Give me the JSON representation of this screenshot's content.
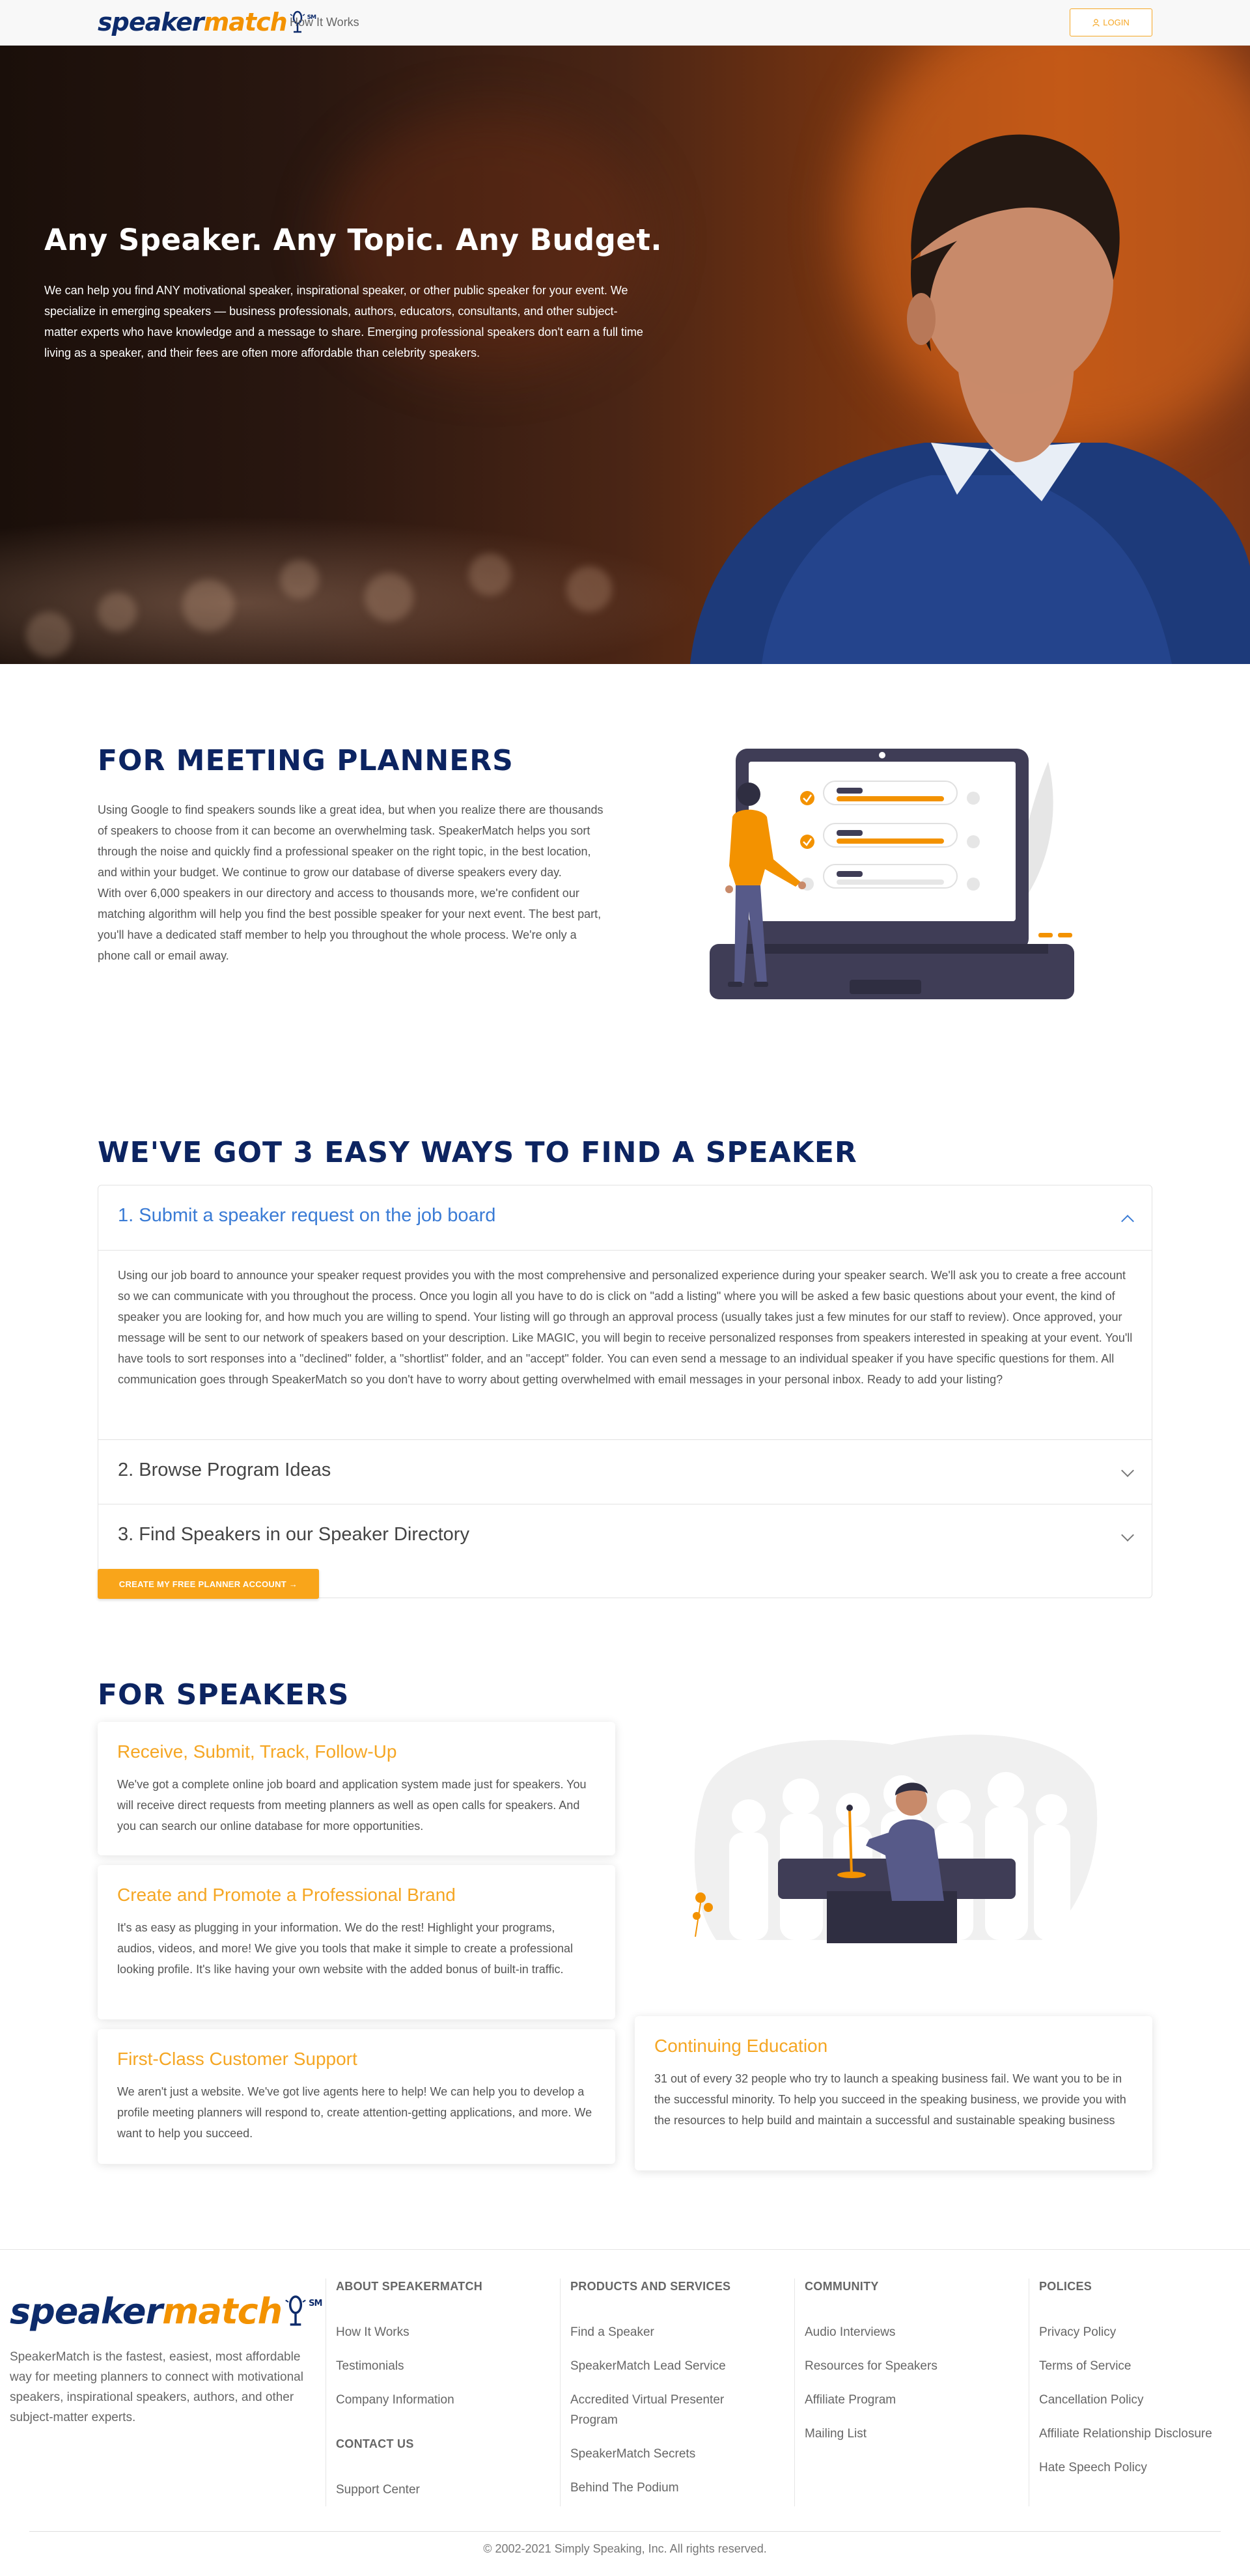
{
  "nav": {
    "logo_speaker": "speaker",
    "logo_match": "match",
    "logo_sm": "SM",
    "how_it_works": "How It Works",
    "login": "LOGIN"
  },
  "hero": {
    "title": "Any Speaker. Any Topic. Any Budget.",
    "text": "We can help you find ANY motivational speaker, inspirational speaker, or other public speaker for your event. We specialize in emerging speakers — business professionals, authors, educators, consultants, and other subject-matter experts who have knowledge and a message to share. Emerging professional speakers don't earn a full time living as a speaker, and their fees are often more affordable than celebrity speakers."
  },
  "meeting_planners": {
    "title": "FOR MEETING PLANNERS",
    "p1": "Using Google to find speakers sounds like a great idea, but when you realize there are thousands of speakers to choose from it can become an overwhelming task. SpeakerMatch helps you sort through the noise and quickly find a professional speaker on the right topic, in the best location, and within your budget. We continue to grow our database of diverse speakers every day.",
    "p2": "With over 6,000 speakers in our directory and access to thousands more, we're confident our matching algorithm will help you find the best possible speaker for your next event. The best part, you'll have a dedicated staff member to help you throughout the whole process. We're only a phone call or email away."
  },
  "ways": {
    "title": "WE'VE GOT 3 EASY WAYS TO FIND A SPEAKER",
    "items": [
      {
        "label": "1. Submit a speaker request on the job board"
      },
      {
        "label": "2. Browse Program Ideas"
      },
      {
        "label": "3. Find Speakers in our Speaker Directory"
      }
    ],
    "body": "Using our job board to announce your speaker request provides you with the most comprehensive and personalized experience during your speaker search. We'll ask you to create a free account so we can communicate with you throughout the process. Once you login all you have to do is click on \"add a listing\" where you will be asked a few basic questions about your event, the kind of speaker you are looking for, and how much you are willing to spend. Your listing will go through an approval process (usually takes just a few minutes for our staff to review). Once approved, your message will be sent to our network of speakers based on your description. Like MAGIC, you will begin to receive personalized responses from speakers interested in speaking at your event. You'll have tools to sort responses into a \"declined\" folder, a \"shortlist\" folder, and an \"accept\" folder. You can even send a message to an individual speaker if you have specific questions for them. All communication goes through SpeakerMatch so you don't have to worry about getting overwhelmed with email messages in your personal inbox. Ready to add your listing?",
    "cta": "CREATE MY FREE PLANNER ACCOUNT →"
  },
  "speakers": {
    "title": "FOR SPEAKERS",
    "cards": [
      {
        "title": "Receive, Submit, Track, Follow-Up",
        "text": "We've got a complete online job board and application system made just for speakers. You will receive direct requests from meeting planners as well as open calls for speakers. And you can search our online database for more opportunities."
      },
      {
        "title": "Create and Promote a Professional Brand",
        "text": "It's as easy as plugging in your information. We do the rest! Highlight your programs, audios, videos, and more! We give you tools that make it simple to create a professional looking profile. It's like having your own website with the added bonus of built-in traffic."
      },
      {
        "title": "First-Class Customer Support",
        "text": "We aren't just a website. We've got live agents here to help! We can help you to develop a profile meeting planners will respond to, create attention-getting applications, and more. We want to help you succeed."
      },
      {
        "title": "Continuing Education",
        "text": "31 out of every 32 people who try to launch a speaking business fail. We want you to be in the successful minority. To help you succeed in the speaking business, we provide you with the resources to help build and maintain a successful and sustainable speaking business"
      }
    ]
  },
  "footer": {
    "description": "SpeakerMatch is the fastest, easiest, most affordable way for meeting planners to connect with motivational speakers, inspirational speakers, authors, and other subject-matter experts.",
    "about": {
      "title": "ABOUT SPEAKERMATCH",
      "links": [
        "How It Works",
        "Testimonials",
        "Company Information"
      ]
    },
    "contact": {
      "title": "CONTACT US",
      "links": [
        "Support Center"
      ]
    },
    "products": {
      "title": "PRODUCTS AND SERVICES",
      "links": [
        "Find a Speaker",
        "SpeakerMatch Lead Service",
        "Accredited Virtual Presenter Program",
        "SpeakerMatch Secrets",
        "Behind The Podium"
      ]
    },
    "community": {
      "title": "COMMUNITY",
      "links": [
        "Audio Interviews",
        "Resources for Speakers",
        "Affiliate Program",
        "Mailing List"
      ]
    },
    "policies": {
      "title": "POLICES",
      "links": [
        "Privacy Policy",
        "Terms of Service",
        "Cancellation Policy",
        "Affiliate Relationship Disclosure",
        "Hate Speech Policy"
      ]
    },
    "copyright": "© 2002-2021 Simply Speaking, Inc. All rights reserved."
  },
  "colors": {
    "navy": "#0c2461",
    "orange": "#f5a623",
    "link_blue": "#3a7bd5"
  }
}
